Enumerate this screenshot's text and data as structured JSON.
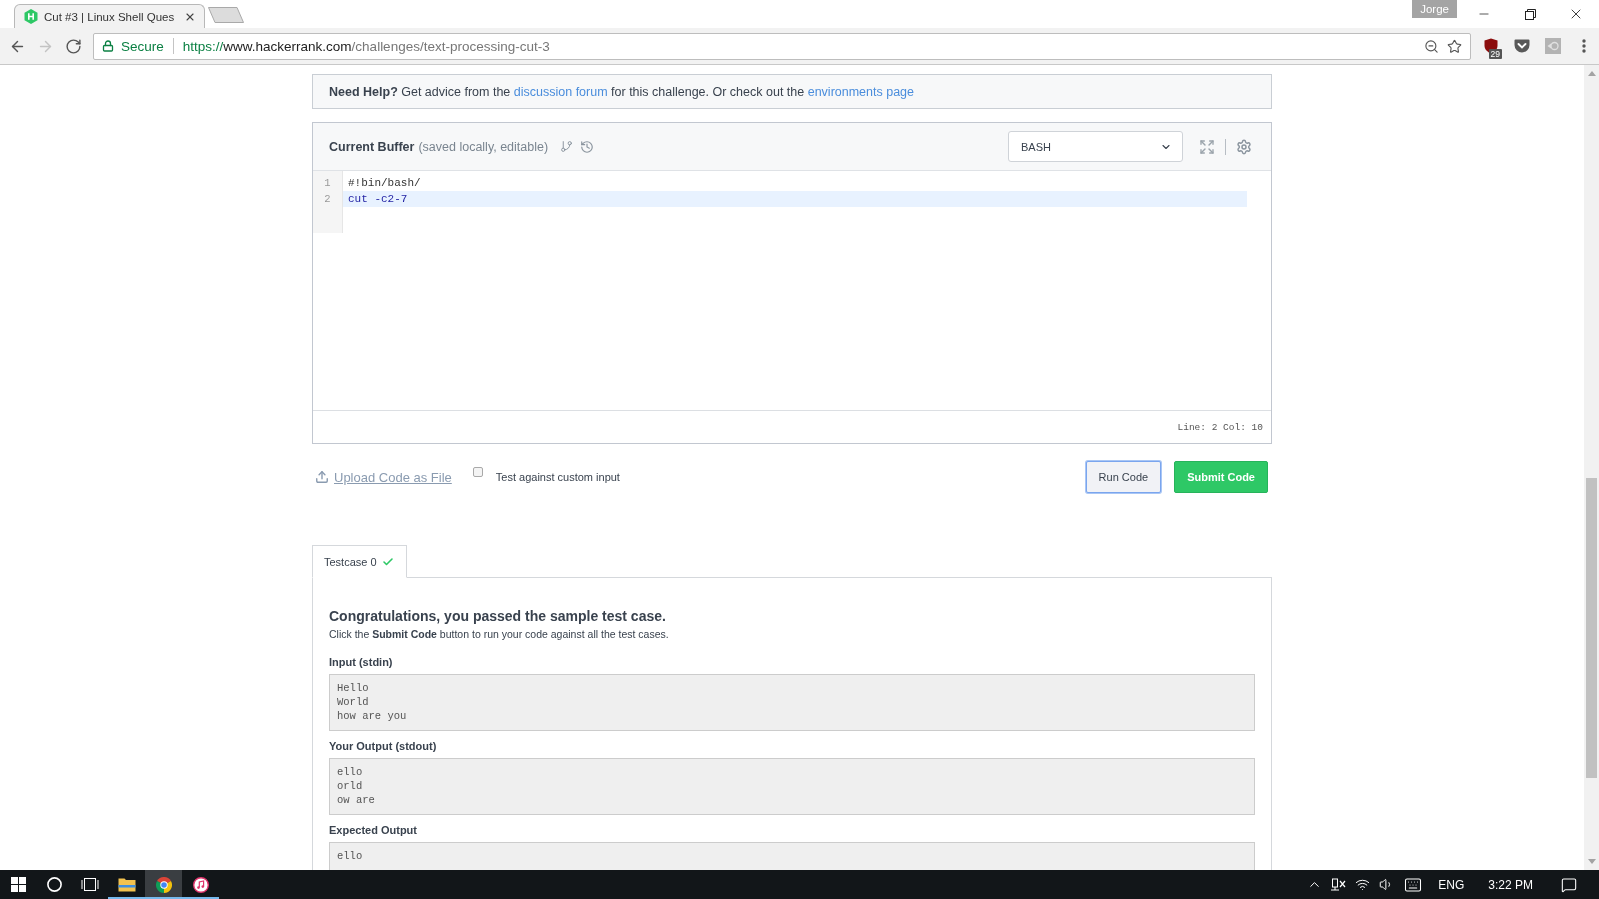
{
  "browser": {
    "tabs": [
      {
        "title": "Cut #3 | Linux Shell Ques",
        "selected": true
      }
    ],
    "profile": "Jorge",
    "nav": [
      {
        "kind": "back",
        "disabled": false
      },
      {
        "kind": "forward",
        "disabled": true
      },
      {
        "kind": "reload",
        "disabled": false
      }
    ],
    "address": {
      "security": "Secure",
      "scheme": "https://",
      "host": "www.hackerrank.com",
      "path": "/challenges/text-processing-cut-3"
    },
    "extensions": [
      {
        "kind": "shield",
        "badge": "29"
      },
      {
        "kind": "pocket"
      },
      {
        "kind": "tile"
      }
    ]
  },
  "help_bar": {
    "parts": [
      {
        "kind": "text",
        "text": "**Need Help?** Get advice from the "
      },
      {
        "kind": "link",
        "text": "discussion forum"
      },
      {
        "kind": "text",
        "text": " for this challenge. Or check out the "
      },
      {
        "kind": "link",
        "text": "environments page"
      }
    ]
  },
  "editor": {
    "title": "Current Buffer",
    "subtitle": "(saved locally, editable)",
    "language": "BASH",
    "lines": [
      {
        "number": "1",
        "code": "#!bin/bash/",
        "active": false
      },
      {
        "number": "2",
        "code": "cut -c2-7",
        "active": true
      }
    ],
    "status": "Line: 2 Col: 10"
  },
  "actions": {
    "upload_label": "Upload Code as File",
    "custom_input": {
      "label": "Test against custom input",
      "checked": false
    },
    "buttons": [
      {
        "kind": "run",
        "label": "Run Code",
        "focused": true
      },
      {
        "kind": "submit",
        "label": "Submit Code",
        "focused": false
      }
    ]
  },
  "testcases": {
    "tabs": [
      {
        "label": "Testcase 0",
        "passed": true,
        "selected": true
      }
    ]
  },
  "result": {
    "heading": "Congratulations, you passed the sample test case.",
    "note": "Click the **Submit Code** button to run your code against all the test cases.",
    "sections": [
      {
        "label": "Input (stdin)",
        "lines": [
          "Hello",
          "World",
          "how are you"
        ]
      },
      {
        "label": "Your Output (stdout)",
        "lines": [
          "ello",
          "orld",
          "ow are"
        ]
      },
      {
        "label": "Expected Output",
        "lines": [
          "ello"
        ]
      }
    ]
  },
  "taskbar": {
    "apps": [
      {
        "kind": "file-explorer",
        "running": true,
        "selected": false
      },
      {
        "kind": "browser",
        "running": true,
        "selected": true
      },
      {
        "kind": "music",
        "running": true,
        "selected": false
      }
    ],
    "language": "ENG",
    "time": "3:22 PM"
  }
}
